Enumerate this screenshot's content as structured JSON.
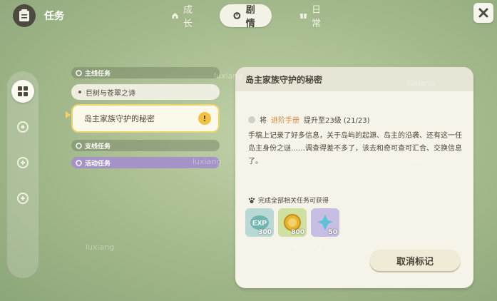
{
  "header": {
    "title": "任务",
    "tabs": [
      {
        "label": "成长",
        "icon": "house-icon",
        "active": false
      },
      {
        "label": "剧情",
        "icon": "clock-icon",
        "active": true
      },
      {
        "label": "日常",
        "icon": "gift-icon",
        "active": false
      }
    ]
  },
  "sidebar": {
    "items": [
      {
        "icon": "grid-icon",
        "active": true
      },
      {
        "icon": "badge-icon-1",
        "active": false
      },
      {
        "icon": "badge-icon-2",
        "active": false
      },
      {
        "icon": "badge-icon-3",
        "active": false
      }
    ]
  },
  "quest_list": {
    "main_section": "主线任务",
    "main_item": "巨树与苍翠之诗",
    "selected_item": "岛主家族守护的秘密",
    "side_section": "支线任务",
    "event_section": "活动任务"
  },
  "detail": {
    "title": "岛主家族守护的秘密",
    "goal_prefix": "将",
    "goal_link": "进阶手册",
    "goal_suffix": "提升至23级 (21/23)",
    "description": "手稿上记录了好多信息，关于岛屿的起源、岛主的沿袭、还有这一任岛主身份之谜……调查得差不多了，该去和奇可查可汇合、交换信息了。",
    "reward_title": "完成全部相关任务可获得",
    "rewards": [
      {
        "name": "EXP",
        "count": "300",
        "color": "#b9d8d6"
      },
      {
        "name": "coin",
        "count": "800",
        "color": "#cfe0a0"
      },
      {
        "name": "gem",
        "count": "50",
        "color": "#c8bde2"
      }
    ],
    "cancel_label": "取消标记"
  },
  "watermark": "luxiang"
}
